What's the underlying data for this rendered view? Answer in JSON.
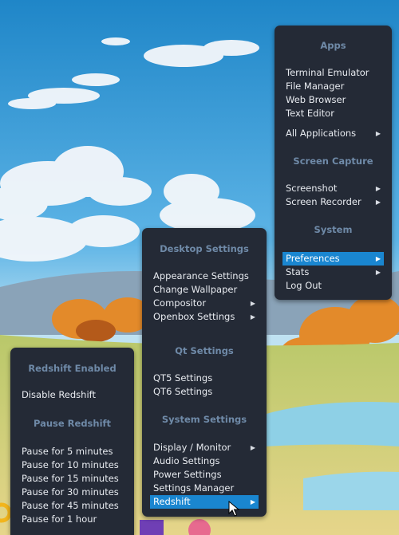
{
  "main_menu": {
    "headers": [
      "Apps",
      "Screen Capture",
      "System"
    ],
    "items": [
      {
        "label": "Terminal Emulator",
        "submenu": false
      },
      {
        "label": "File Manager",
        "submenu": false
      },
      {
        "label": "Web Browser",
        "submenu": false
      },
      {
        "label": "Text Editor",
        "submenu": false
      },
      {
        "label": "All Applications",
        "submenu": true
      },
      {
        "label": "Screenshot",
        "submenu": true
      },
      {
        "label": "Screen Recorder",
        "submenu": true
      },
      {
        "label": "Preferences",
        "submenu": true,
        "active": true
      },
      {
        "label": "Stats",
        "submenu": true
      },
      {
        "label": "Log Out",
        "submenu": false
      }
    ]
  },
  "preferences_menu": {
    "headers": [
      "Desktop Settings",
      "Qt Settings",
      "System Settings"
    ],
    "items": [
      {
        "label": "Appearance Settings",
        "submenu": false
      },
      {
        "label": "Change Wallpaper",
        "submenu": false
      },
      {
        "label": "Compositor",
        "submenu": true
      },
      {
        "label": "Openbox Settings",
        "submenu": true
      },
      {
        "label": "QT5 Settings",
        "submenu": false
      },
      {
        "label": "QT6 Settings",
        "submenu": false
      },
      {
        "label": "Display / Monitor",
        "submenu": true
      },
      {
        "label": "Audio Settings",
        "submenu": false
      },
      {
        "label": "Power Settings",
        "submenu": false
      },
      {
        "label": "Settings Manager",
        "submenu": false
      },
      {
        "label": "Redshift",
        "submenu": true,
        "active": true
      }
    ]
  },
  "redshift_menu": {
    "headers": [
      "Redshift Enabled",
      "Pause Redshift"
    ],
    "items": [
      {
        "label": "Disable Redshift"
      },
      {
        "label": "Pause for 5 minutes"
      },
      {
        "label": "Pause for 10 minutes"
      },
      {
        "label": "Pause for 15 minutes"
      },
      {
        "label": "Pause for 30 minutes"
      },
      {
        "label": "Pause for 45 minutes"
      },
      {
        "label": "Pause for 1 hour"
      }
    ]
  },
  "colors": {
    "menu_bg": "#242a36",
    "header_text": "#6f8aa8",
    "item_text": "#e8ebf0",
    "highlight": "#1a86d0"
  },
  "icons": {
    "submenu_arrow": "submenu-arrow-icon",
    "cursor": "mouse-pointer-icon"
  }
}
